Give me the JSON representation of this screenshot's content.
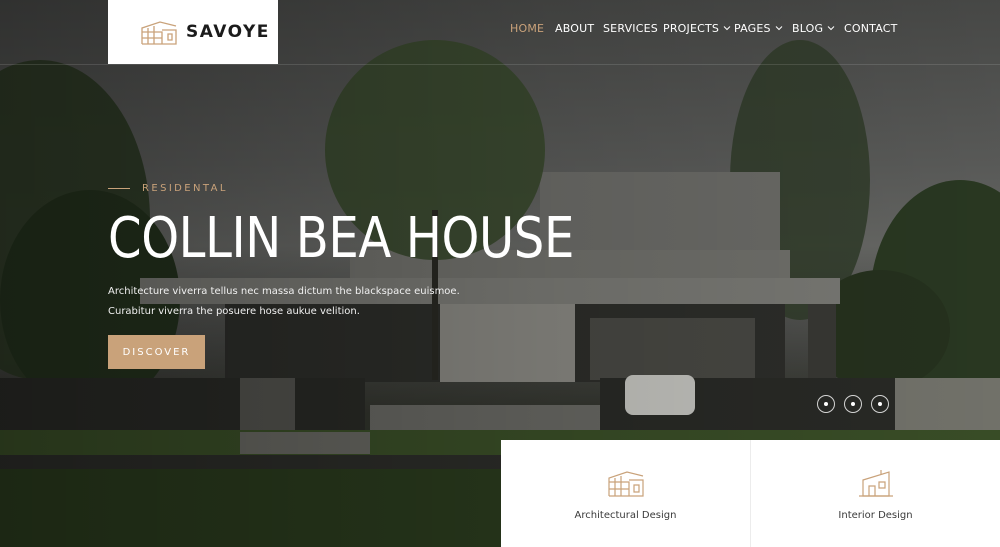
{
  "brand": {
    "name": "SAVOYE",
    "logo_icon": "building-icon"
  },
  "nav": {
    "items": [
      {
        "label": "HOME",
        "active": true,
        "dropdown": false
      },
      {
        "label": "ABOUT",
        "active": false,
        "dropdown": false
      },
      {
        "label": "SERVICES",
        "active": false,
        "dropdown": false
      },
      {
        "label": "PROJECTS",
        "active": false,
        "dropdown": true
      },
      {
        "label": "PAGES",
        "active": false,
        "dropdown": true
      },
      {
        "label": "BLOG",
        "active": false,
        "dropdown": true
      },
      {
        "label": "CONTACT",
        "active": false,
        "dropdown": false
      }
    ]
  },
  "hero": {
    "eyebrow": "RESIDENTAL",
    "title": "COLLIN BEA HOUSE",
    "desc_line1": "Architecture viverra tellus nec massa dictum the blackspace euismoe.",
    "desc_line2": "Curabitur viverra the posuere hose aukue velition.",
    "button_label": "DISCOVER"
  },
  "slider": {
    "dot_count": 3
  },
  "services": [
    {
      "label": "Architectural Design",
      "icon": "architecture-icon"
    },
    {
      "label": "Interior Design",
      "icon": "interior-icon"
    }
  ],
  "colors": {
    "accent": "#c9a27a",
    "white": "#ffffff",
    "text_dark": "#3a3a3a"
  }
}
